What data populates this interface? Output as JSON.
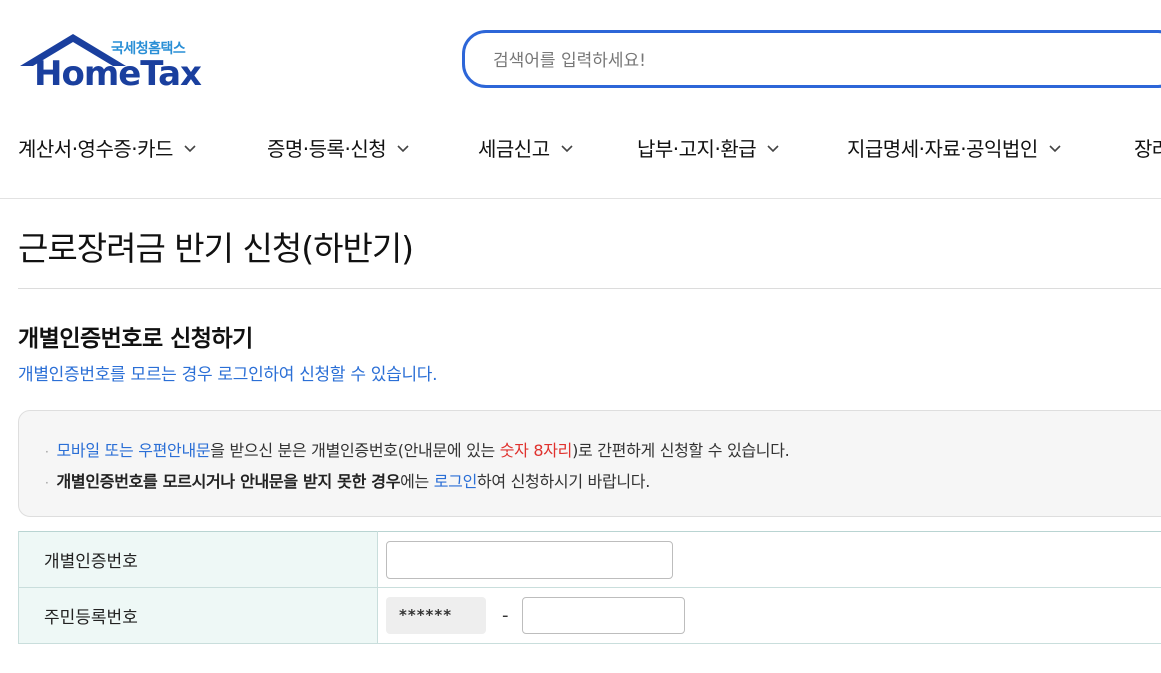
{
  "header": {
    "logo_sub": "국세청홈택스",
    "logo_main": "HomeTax",
    "search_placeholder": "검색어를 입력하세요!",
    "nav": [
      {
        "label": "계산서·영수증·카드"
      },
      {
        "label": "증명·등록·신청"
      },
      {
        "label": "세금신고"
      },
      {
        "label": "납부·고지·환급"
      },
      {
        "label": "지급명세·자료·공익법인"
      },
      {
        "label": "장려"
      }
    ]
  },
  "page": {
    "title": "근로장려금 반기 신청(하반기)",
    "section_title": "개별인증번호로 신청하기",
    "section_desc": "개별인증번호를 모르는 경우 로그인하여 신청할 수 있습니다."
  },
  "notice": {
    "line1": {
      "blue1": "모바일 또는 우편안내문",
      "text1": "을 받으신 분은 개별인증번호(안내문에 있는 ",
      "red": "숫자 8자리",
      "text2": ")로 간편하게 신청할 수 있습니다."
    },
    "line2": {
      "bold": "개별인증번호를 모르시거나 안내문을 받지 못한 경우",
      "text1": "에는 ",
      "blue": "로그인",
      "text2": "하여 신청하시기 바랍니다."
    }
  },
  "form": {
    "auth_label": "개별인증번호",
    "auth_value": "",
    "rrn_label": "주민등록번호",
    "rrn_masked": "******",
    "rrn_dash": "-",
    "rrn_back_value": ""
  },
  "colors": {
    "brand": "#1a3f9e",
    "search_border": "#2d66d8",
    "link_blue": "#2b6fd6",
    "highlight_red": "#e0322e",
    "table_header_bg": "#eef8f6"
  }
}
